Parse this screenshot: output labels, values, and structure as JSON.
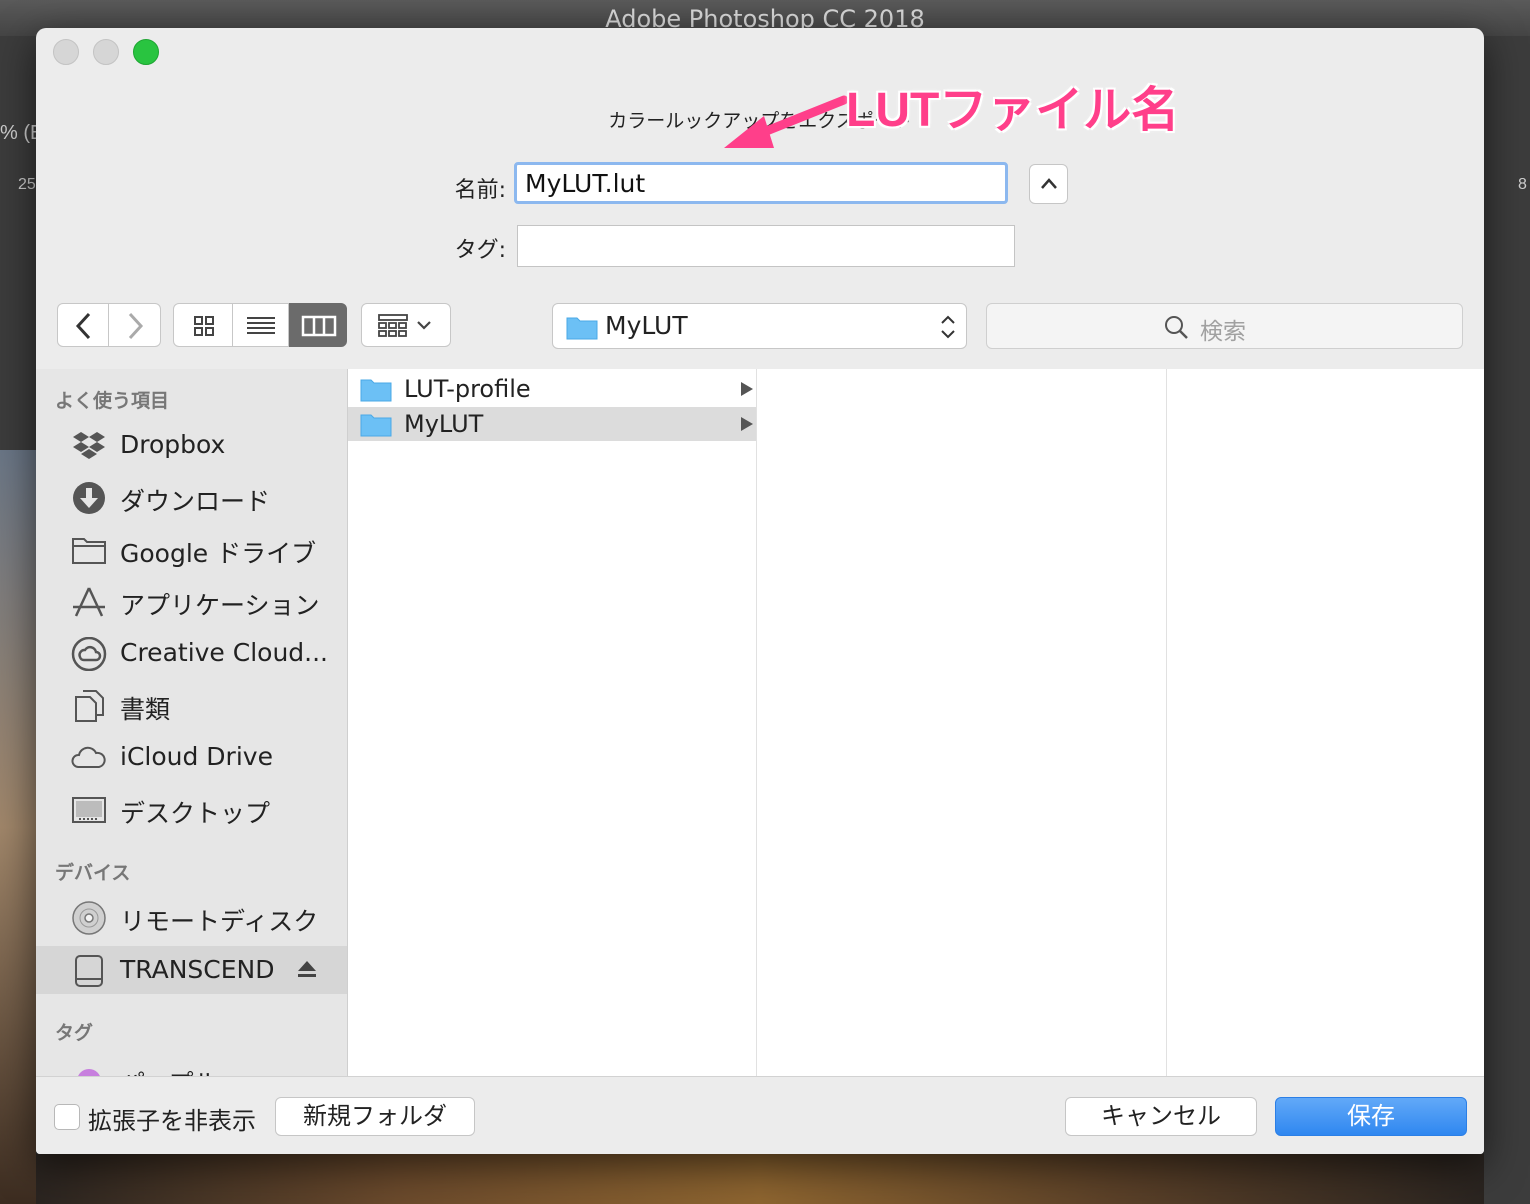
{
  "app": {
    "window_title": "Adobe Photoshop CC 2018",
    "left_fragments": [
      "% (E",
      "25"
    ],
    "right_fragment": "8"
  },
  "dialog": {
    "prompt": "カラールックアップをエクスポート",
    "annotation": "LUTファイル名",
    "name_label": "名前:",
    "name_value": "MyLUT.lut",
    "tag_label": "タグ:",
    "tag_value": ""
  },
  "toolbar": {
    "location": "MyLUT",
    "search_placeholder": "検索"
  },
  "sidebar": {
    "favorites_header": "よく使う項目",
    "favorites": [
      {
        "label": "Dropbox",
        "icon": "dropbox-icon"
      },
      {
        "label": "ダウンロード",
        "icon": "download-icon"
      },
      {
        "label": "Google ドライブ",
        "icon": "folder-icon"
      },
      {
        "label": "アプリケーション",
        "icon": "applications-icon"
      },
      {
        "label": "Creative Cloud...",
        "icon": "creative-cloud-icon"
      },
      {
        "label": "書類",
        "icon": "documents-icon"
      },
      {
        "label": "iCloud Drive",
        "icon": "cloud-icon"
      },
      {
        "label": "デスクトップ",
        "icon": "desktop-icon"
      }
    ],
    "devices_header": "デバイス",
    "devices": [
      {
        "label": "リモートディスク",
        "icon": "disc-icon"
      },
      {
        "label": "TRANSCEND",
        "icon": "drive-icon",
        "selected": true
      }
    ],
    "tags_header": "タグ",
    "tags": [
      {
        "label": "パープル",
        "color": "#c77fde"
      }
    ]
  },
  "files": [
    {
      "name": "LUT-profile",
      "selected": false
    },
    {
      "name": "MyLUT",
      "selected": true
    }
  ],
  "bottom": {
    "hide_extension": "拡張子を非表示",
    "new_folder": "新規フォルダ",
    "cancel": "キャンセル",
    "save": "保存"
  },
  "colors": {
    "accent": "#2f87f0",
    "annotation": "#ff3f8a",
    "folder": "#6cc0f5",
    "focus_ring": "#8cb8ef"
  }
}
